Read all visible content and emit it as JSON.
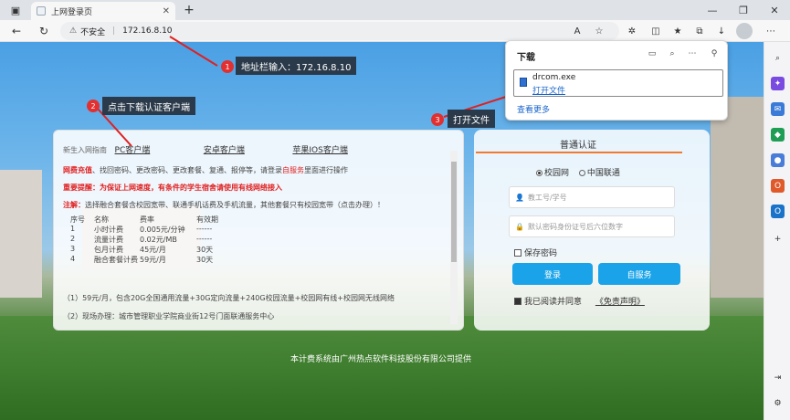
{
  "browser": {
    "tab_title": "上网登录页",
    "address_warning": "不安全",
    "address_url": "172.16.8.10"
  },
  "download_panel": {
    "title": "下载",
    "file_name": "drcom.exe",
    "open_label": "打开文件",
    "see_more": "查看更多"
  },
  "annotations": [
    {
      "num": "1",
      "text": "地址栏输入：172.16.8.10"
    },
    {
      "num": "2",
      "text": "点击下载认证客户端"
    },
    {
      "num": "3",
      "text": "打开文件"
    }
  ],
  "left_panel": {
    "guide_label": "新生入网指南",
    "links": [
      "PC客户端",
      "安卓客户端",
      "苹果IOS客户端"
    ],
    "notice1_red": "网费充值",
    "notice1_a": "、找回密码、更改密码、更改套餐、复通、报停等，请登录",
    "notice1_self": "自服务",
    "notice1_b": "里面进行操作",
    "notice2": "重要提醒：为保证上网速度，有条件的学生宿舍请使用有线网络接入",
    "notice3_red": "注解：",
    "notice3": "选择融合套餐含校园宽带、联通手机话费及手机流量，其他套餐只有校园宽带（点击办理）！",
    "table_headers": [
      "序号",
      "名称",
      "费率",
      "有效期"
    ],
    "table_rows": [
      [
        "1",
        "小时计费",
        "0.005元/分钟",
        "------"
      ],
      [
        "2",
        "流量计费",
        "0.02元/MB",
        "------"
      ],
      [
        "3",
        "包月计费",
        "45元/月",
        "30天"
      ],
      [
        "4",
        "融合套餐计费",
        "59元/月",
        "30天"
      ]
    ],
    "note1": "（1）59元/月，包含20G全国通用流量+30G定向流量+240G校园流量+校园网有线+校园网无线网络",
    "note2": "（2）现场办理：城市管理职业学院商业街12号门面联通服务中心"
  },
  "login": {
    "tab": "普通认证",
    "radio1": "校园网",
    "radio2": "中国联通",
    "username_placeholder": "教工号/学号",
    "password_placeholder": "默认密码身份证号后六位数字",
    "save_password": "保存密码",
    "login_btn": "登录",
    "self_service_btn": "自服务",
    "agree_text": "我已阅读并同意",
    "disclaimer": "《免责声明》"
  },
  "footer": "本计费系统由广州热点软件科技股份有限公司提供"
}
